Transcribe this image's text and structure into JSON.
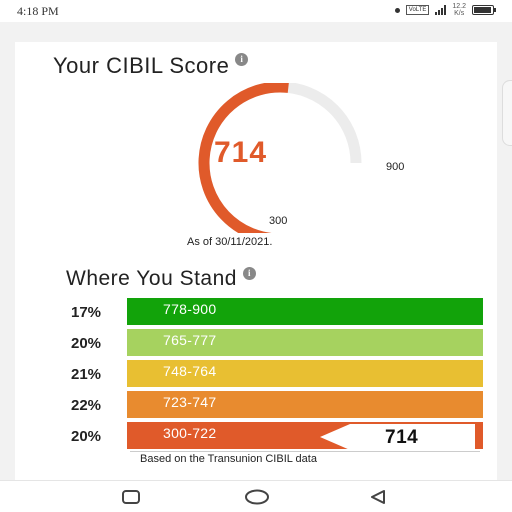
{
  "status_bar": {
    "time": "4:18 PM",
    "network_label": "VoLTE",
    "speed_value": "12.2",
    "speed_unit": "K/s",
    "icons": [
      "notification-dot-icon",
      "signal-icon",
      "battery-icon"
    ]
  },
  "score_card": {
    "title": "Your CIBIL Score",
    "score": "714",
    "min": "300",
    "max": "900",
    "score_fraction": 0.69,
    "as_of": "As of 30/11/2021.",
    "accent_color": "#e05a2a"
  },
  "stand": {
    "title": "Where You Stand",
    "bands": [
      {
        "percent": "17%",
        "range": "778-900",
        "color": "#12a30a"
      },
      {
        "percent": "20%",
        "range": "765-777",
        "color": "#a6d25f"
      },
      {
        "percent": "21%",
        "range": "748-764",
        "color": "#e8bf32"
      },
      {
        "percent": "22%",
        "range": "723-747",
        "color": "#e88b2f"
      },
      {
        "percent": "20%",
        "range": "300-722",
        "color": "#e05a2a"
      }
    ],
    "user_score": "714",
    "note": "Based on the Transunion CIBIL data"
  },
  "nav": {
    "icons": [
      "recent-apps-icon",
      "home-icon",
      "back-icon"
    ]
  }
}
